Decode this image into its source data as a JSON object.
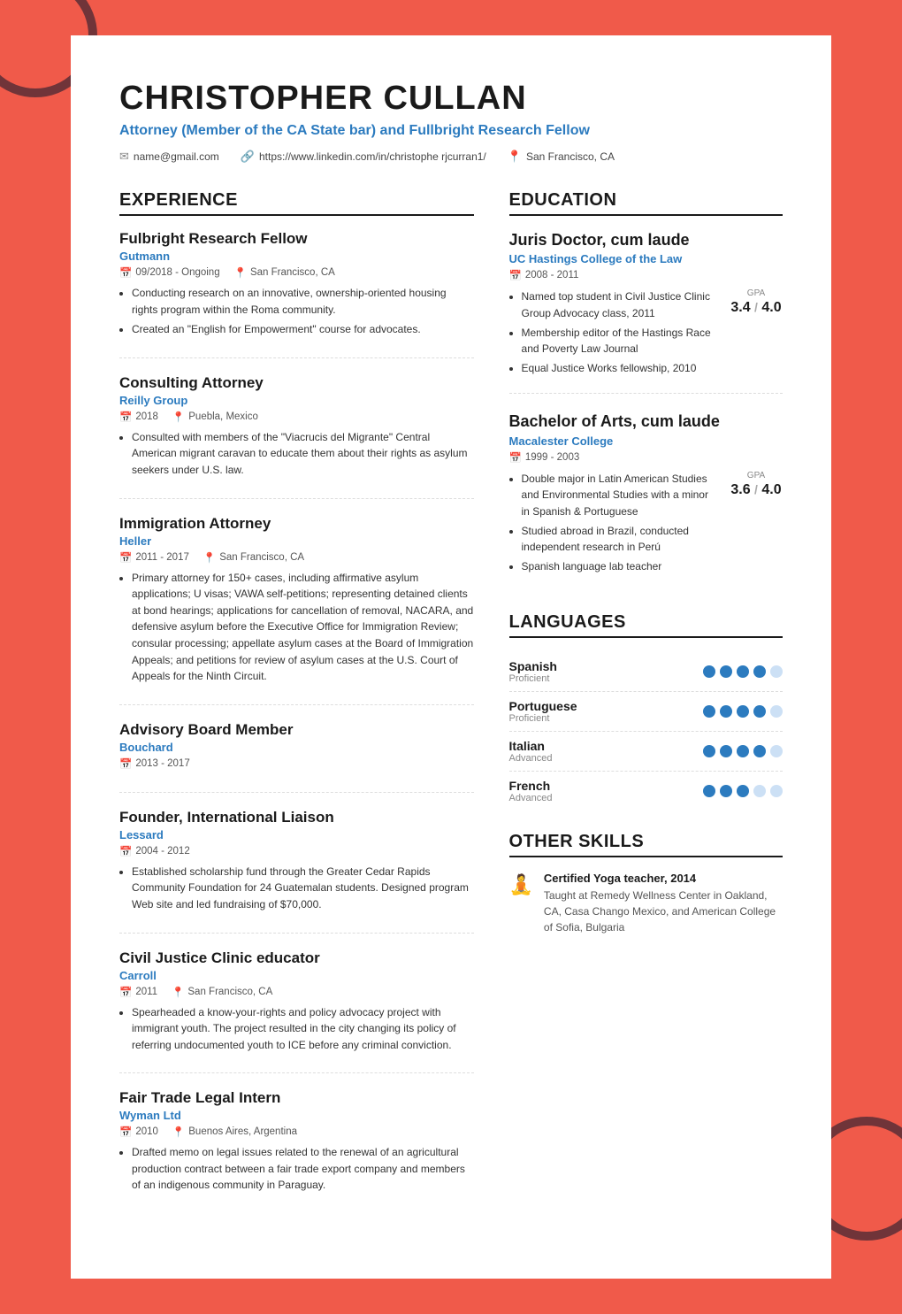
{
  "header": {
    "name": "CHRISTOPHER CULLAN",
    "title": "Attorney (Member of the CA State bar) and Fullbright Research Fellow",
    "email": "name@gmail.com",
    "linkedin": "https://www.linkedin.com/in/christophe rjcurran1/",
    "location": "San Francisco, CA"
  },
  "sections": {
    "experience_label": "EXPERIENCE",
    "education_label": "EDUCATION",
    "languages_label": "LANGUAGES",
    "skills_label": "OTHER SKILLS"
  },
  "experience": [
    {
      "title": "Fulbright Research Fellow",
      "company": "Gutmann",
      "date": "09/2018 - Ongoing",
      "location": "San Francisco, CA",
      "bullets": [
        "Conducting research on an innovative, ownership-oriented housing rights program within the Roma community.",
        "Created an \"English for Empowerment\" course for advocates."
      ]
    },
    {
      "title": "Consulting Attorney",
      "company": "Reilly Group",
      "date": "2018",
      "location": "Puebla, Mexico",
      "bullets": [
        "Consulted with members of the \"Viacrucis del Migrante\" Central American migrant caravan to educate them about their rights as asylum seekers under U.S. law."
      ]
    },
    {
      "title": "Immigration Attorney",
      "company": "Heller",
      "date": "2011 - 2017",
      "location": "San Francisco, CA",
      "bullets": [
        "Primary attorney for 150+ cases, including affirmative asylum applications; U visas; VAWA self-petitions; representing detained clients at bond hearings; applications for cancellation of removal, NACARA, and defensive asylum before the Executive Office for Immigration Review; consular processing; appellate asylum cases at the Board of Immigration Appeals; and petitions for review of asylum cases at the U.S. Court of Appeals for the Ninth Circuit."
      ]
    },
    {
      "title": "Advisory Board Member",
      "company": "Bouchard",
      "date": "2013 - 2017",
      "location": "",
      "bullets": []
    },
    {
      "title": "Founder, International Liaison",
      "company": "Lessard",
      "date": "2004 - 2012",
      "location": "",
      "bullets": [
        "Established scholarship fund through the Greater Cedar Rapids Community Foundation for 24 Guatemalan students. Designed program Web site and led fundraising of $70,000."
      ]
    },
    {
      "title": "Civil Justice Clinic educator",
      "company": "Carroll",
      "date": "2011",
      "location": "San Francisco, CA",
      "bullets": [
        "Spearheaded a know-your-rights and policy advocacy project with immigrant youth. The project resulted in the city changing its policy of referring undocumented youth to ICE before any criminal conviction."
      ]
    },
    {
      "title": "Fair Trade Legal Intern",
      "company": "Wyman Ltd",
      "date": "2010",
      "location": "Buenos Aires, Argentina",
      "bullets": [
        "Drafted memo on legal issues related to the renewal of an agricultural production contract between a fair trade export company and members of an indigenous community in Paraguay."
      ]
    }
  ],
  "education": [
    {
      "degree": "Juris Doctor, cum laude",
      "school": "UC Hastings College of the Law",
      "dates": "2008 - 2011",
      "gpa": "3.4",
      "gpa_max": "4.0",
      "bullets": [
        "Named top student in Civil Justice Clinic Group Advocacy class, 2011",
        "Membership editor of the Hastings Race and Poverty Law Journal",
        "Equal Justice Works fellowship, 2010"
      ]
    },
    {
      "degree": "Bachelor of Arts, cum laude",
      "school": "Macalester College",
      "dates": "1999 - 2003",
      "gpa": "3.6",
      "gpa_max": "4.0",
      "bullets": [
        "Double major in Latin American Studies and Environmental Studies with a minor in Spanish & Portuguese",
        "Studied abroad in Brazil, conducted independent research in Perú",
        "Spanish language lab teacher"
      ]
    }
  ],
  "languages": [
    {
      "name": "Spanish",
      "level": "Proficient",
      "filled": 4,
      "total": 5
    },
    {
      "name": "Portuguese",
      "level": "Proficient",
      "filled": 4,
      "total": 5
    },
    {
      "name": "Italian",
      "level": "Advanced",
      "filled": 4,
      "total": 5
    },
    {
      "name": "French",
      "level": "Advanced",
      "filled": 3,
      "total": 5
    }
  ],
  "other_skills": [
    {
      "icon": "🧘",
      "title": "Certified Yoga teacher, 2014",
      "desc": "Taught at Remedy Wellness Center in Oakland, CA, Casa Chango Mexico, and American College of Sofia, Bulgaria"
    }
  ]
}
